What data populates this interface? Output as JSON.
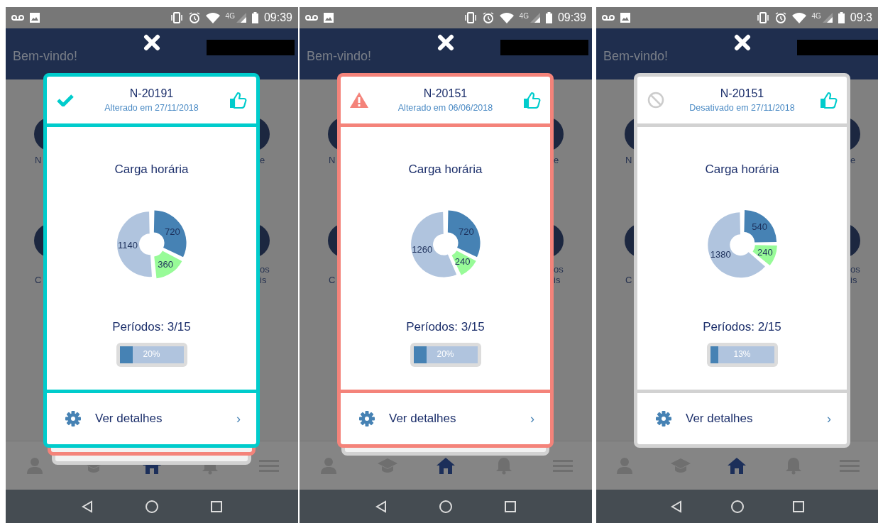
{
  "panels": [
    {
      "status_bar": {
        "network": "4G",
        "time": "09:39"
      },
      "header": {
        "greeting": "Bem-vindo!"
      },
      "backdrop": {
        "left_texts": [
          "N",
          "C"
        ],
        "right_texts": [
          "e",
          "os",
          "is"
        ]
      },
      "stacked_cards": [
        {
          "color": "#f4837a"
        },
        {
          "color": "#d2d2d2"
        }
      ],
      "card": {
        "kind": "ok",
        "color": "#00cccc",
        "code": "N-20191",
        "updated": "Alterado em 27/11/2018",
        "chart_title": "Carga horária",
        "chart_data": {
          "type": "donut",
          "values": [
            720,
            360,
            1140
          ],
          "colors": [
            "#4682b4",
            "#98fb98",
            "#b0c4de"
          ],
          "data_labels": true
        },
        "periods": "Períodos: 3/15",
        "progress": {
          "level": 0.2,
          "label": "20%"
        },
        "action": "Ver detalhes",
        "chevron": "›"
      },
      "nav": [
        {
          "kind": "person",
          "selected": false
        },
        {
          "kind": "cap",
          "selected": false
        },
        {
          "kind": "home",
          "selected": true
        },
        {
          "kind": "bell",
          "selected": false
        },
        {
          "kind": "menu",
          "selected": false
        }
      ]
    },
    {
      "status_bar": {
        "network": "4G",
        "time": "09:39"
      },
      "header": {
        "greeting": "Bem-vindo!"
      },
      "backdrop": {
        "left_texts": [
          "N",
          "C"
        ],
        "right_texts": [
          "e",
          "os",
          "is"
        ]
      },
      "stacked_cards": [
        {
          "color": "#d2d2d2"
        }
      ],
      "card": {
        "kind": "warning",
        "color": "#f4837a",
        "code": "N-20151",
        "updated": "Alterado em 06/06/2018",
        "chart_title": "Carga horária",
        "chart_data": {
          "type": "donut",
          "values": [
            720,
            240,
            1260
          ],
          "colors": [
            "#4682b4",
            "#98fb98",
            "#b0c4de"
          ],
          "data_labels": true
        },
        "periods": "Períodos: 3/15",
        "progress": {
          "level": 0.2,
          "label": "20%"
        },
        "action": "Ver detalhes",
        "chevron": "›"
      },
      "nav": [
        {
          "kind": "person",
          "selected": false
        },
        {
          "kind": "cap",
          "selected": false
        },
        {
          "kind": "home",
          "selected": true
        },
        {
          "kind": "bell",
          "selected": false
        },
        {
          "kind": "menu",
          "selected": false
        }
      ]
    },
    {
      "status_bar": {
        "network": "4G",
        "time": "09:3"
      },
      "header": {
        "greeting": "Bem-vindo!"
      },
      "backdrop": {
        "left_texts": [
          "N",
          "C"
        ],
        "right_texts": [
          "e",
          "os",
          "is"
        ]
      },
      "card": {
        "kind": "disabled",
        "color": "#d2d2d2",
        "code": "N-20151",
        "updated": "Desativado em 27/11/2018",
        "chart_title": "Carga horária",
        "chart_data": {
          "type": "donut",
          "values": [
            540,
            240,
            1380
          ],
          "colors": [
            "#4682b4",
            "#98fb98",
            "#b0c4de"
          ],
          "data_labels": true
        },
        "periods": "Períodos: 2/15",
        "progress": {
          "level": 0.13,
          "label": "13%"
        },
        "action": "Ver detalhes",
        "chevron": "›"
      },
      "nav": [
        {
          "kind": "person",
          "selected": false
        },
        {
          "kind": "cap",
          "selected": false
        },
        {
          "kind": "home",
          "selected": true
        },
        {
          "kind": "bell",
          "selected": false
        },
        {
          "kind": "menu",
          "selected": false
        }
      ]
    }
  ]
}
